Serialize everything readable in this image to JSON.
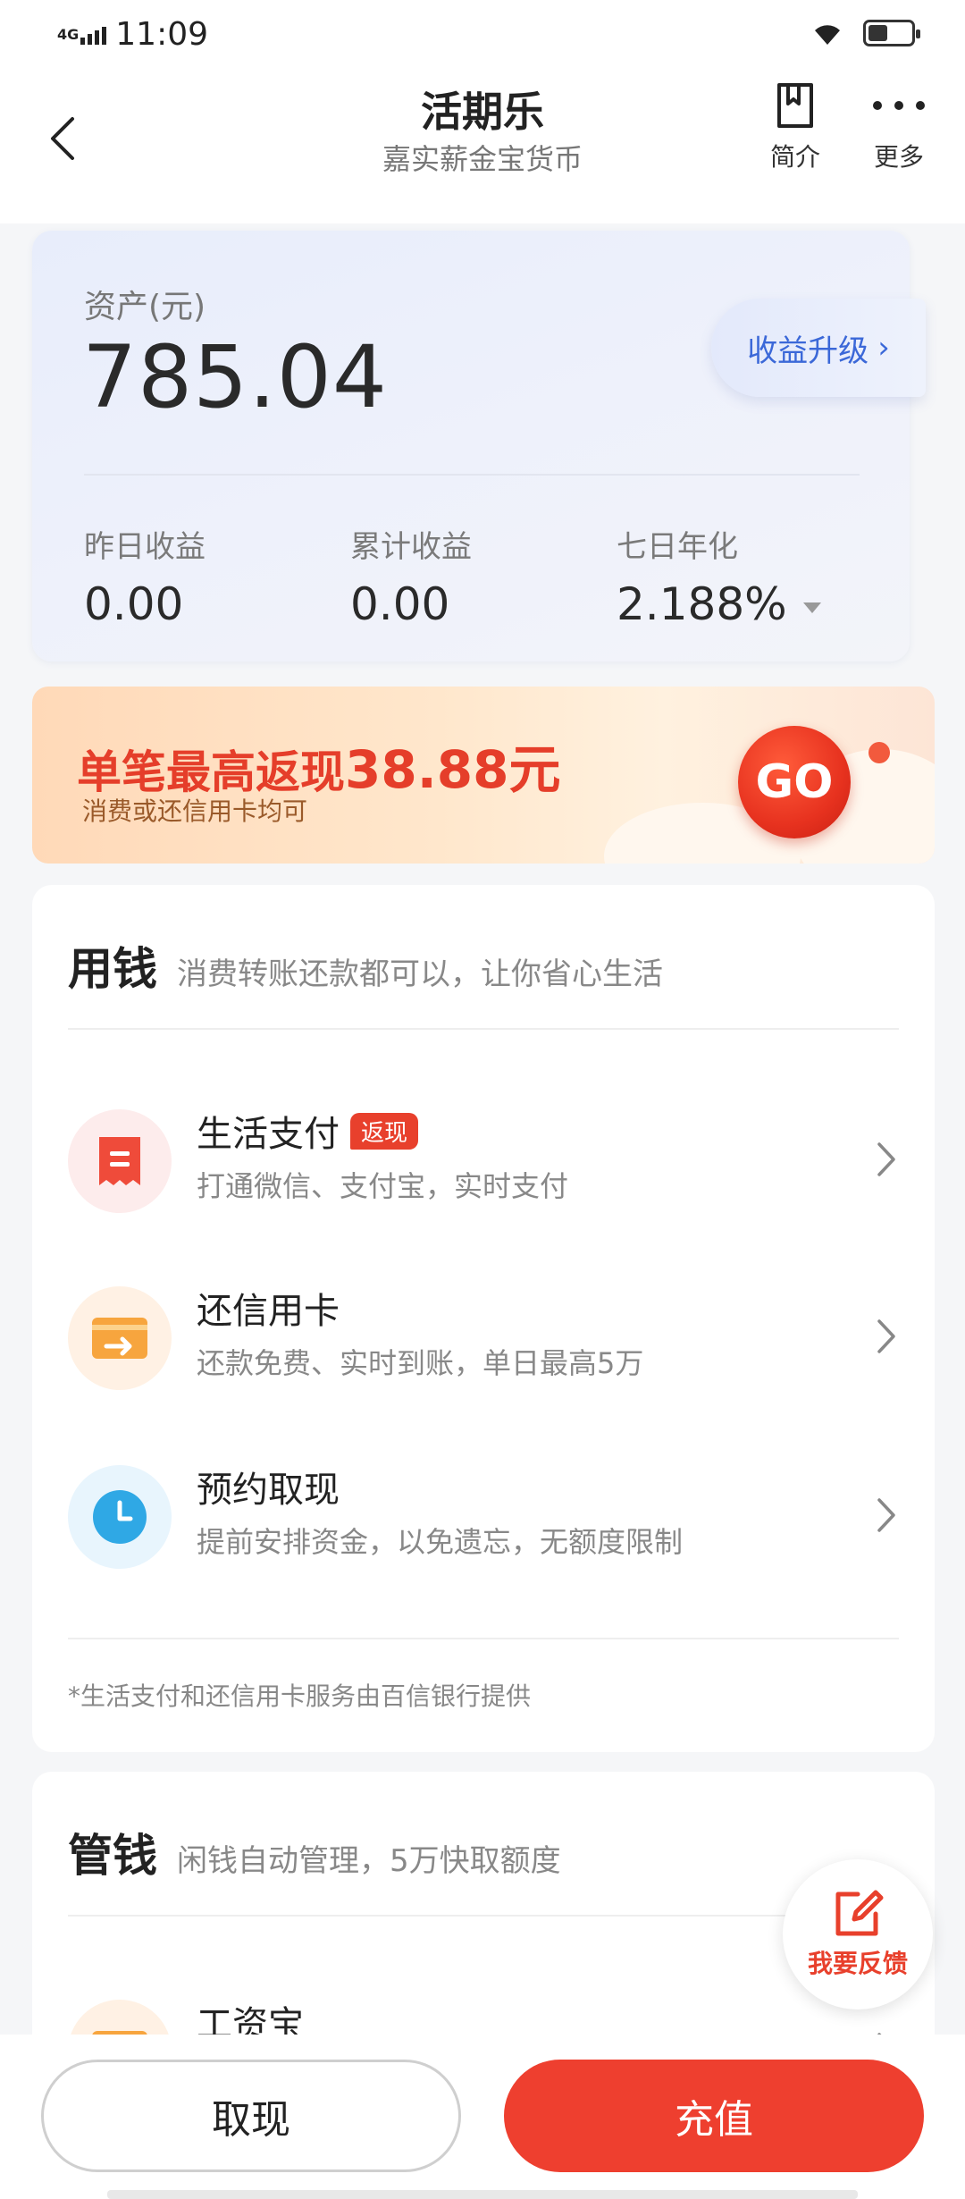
{
  "status_bar": {
    "network": "4G",
    "time": "11:09",
    "battery_level": 0.45
  },
  "header": {
    "title": "活期乐",
    "subtitle": "嘉实薪金宝货币",
    "intro_label": "简介",
    "more_label": "更多"
  },
  "asset": {
    "label": "资产(元)",
    "value": "785.04",
    "upgrade_label": "收益升级",
    "stats": [
      {
        "label": "昨日收益",
        "value": "0.00"
      },
      {
        "label": "累计收益",
        "value": "0.00"
      },
      {
        "label": "七日年化",
        "value": "2.188%"
      }
    ]
  },
  "promo": {
    "title_prefix": "单笔最高返现",
    "title_amount": "38.88元",
    "subtitle": "消费或还信用卡均可",
    "go_label": "GO"
  },
  "use_section": {
    "heading": "用钱",
    "description": "消费转账还款都可以，让你省心生活",
    "items": [
      {
        "title": "生活支付",
        "badge": "返现",
        "subtitle": "打通微信、支付宝，实时支付"
      },
      {
        "title": "还信用卡",
        "subtitle": "还款免费、实时到账，单日最高5万"
      },
      {
        "title": "预约取现",
        "subtitle": "提前安排资金，以免遗忘，无额度限制"
      }
    ],
    "footnote": "*生活支付和还信用卡服务由百信银行提供"
  },
  "manage_section": {
    "heading": "管钱",
    "description": "闲钱自动管理，5万快取额度",
    "items": [
      {
        "title": "工资宝"
      }
    ]
  },
  "feedback": {
    "label": "我要反馈"
  },
  "bottom": {
    "withdraw_label": "取现",
    "recharge_label": "充值"
  },
  "colors": {
    "accent": "#ee3f2f",
    "link_blue": "#3b68d8"
  }
}
